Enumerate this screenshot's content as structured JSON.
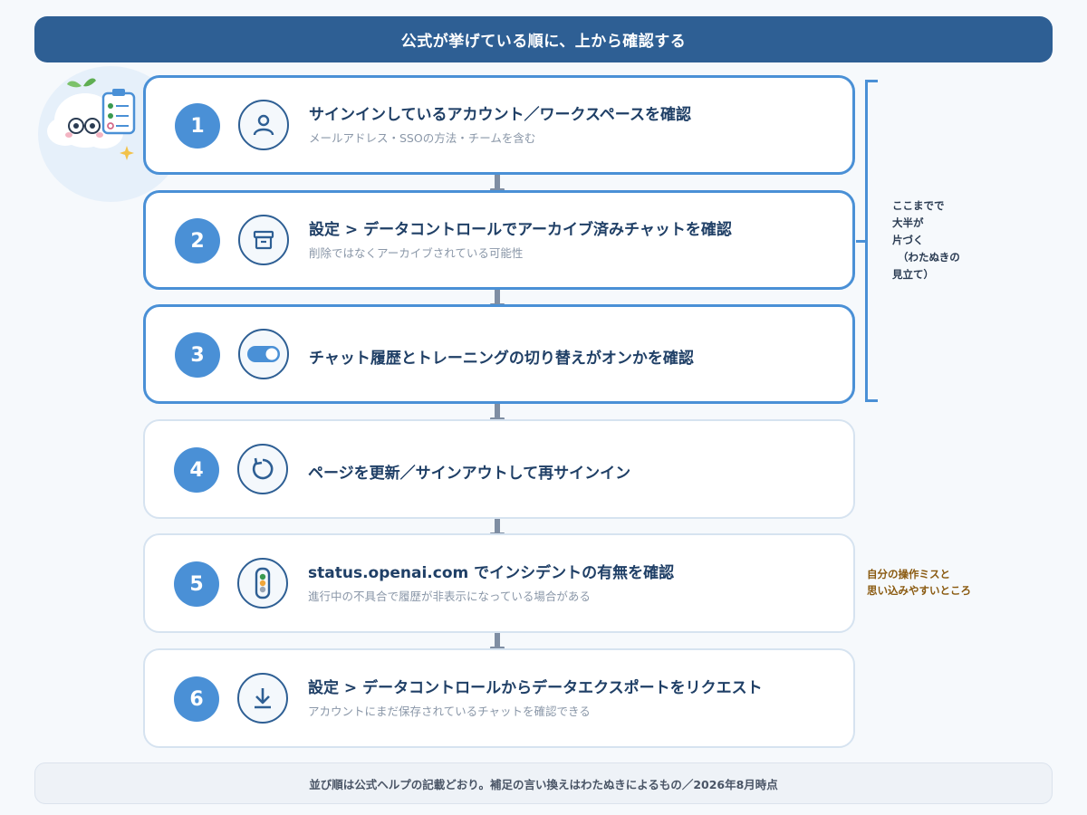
{
  "header": {
    "title": "公式が挙げている順に、上から確認する"
  },
  "steps": [
    {
      "number": "1",
      "icon": "user-icon",
      "title": "サインインしているアカウント／ワークスペースを確認",
      "subtitle": "メールアドレス・SSOの方法・チームを含む",
      "highlighted": true
    },
    {
      "number": "2",
      "icon": "archive-box-icon",
      "title": "設定 > データコントロールでアーカイブ済みチャットを確認",
      "subtitle": "削除ではなくアーカイブされている可能性",
      "highlighted": true
    },
    {
      "number": "3",
      "icon": "toggle-switch-icon",
      "title": "チャット履歴とトレーニングの切り替えがオンかを確認",
      "subtitle": "",
      "highlighted": true
    },
    {
      "number": "4",
      "icon": "refresh-icon",
      "title": "ページを更新／サインアウトして再サインイン",
      "subtitle": "",
      "highlighted": false
    },
    {
      "number": "5",
      "icon": "traffic-light-icon",
      "title": "status.openai.com でインシデントの有無を確認",
      "subtitle": "進行中の不具合で履歴が非表示になっている場合がある",
      "highlighted": false
    },
    {
      "number": "6",
      "icon": "download-icon",
      "title": "設定 > データコントロールからデータエクスポートをリクエスト",
      "subtitle": "アカウントにまだ保存されているチャットを確認できる",
      "highlighted": false
    }
  ],
  "side_note": {
    "line1": "ここまでで",
    "line2": "大半が",
    "line3": "片づく",
    "line4": "（わたぬきの",
    "line5": "見立て）"
  },
  "warn_note": {
    "line1": "自分の操作ミスと",
    "line2": "思い込みやすいところ"
  },
  "footer": {
    "text": "並び順は公式ヘルプの記載どおり。補足の言い換えはわたぬきによるもの／2026年8月時点"
  },
  "colors": {
    "header": "#2e5f94",
    "accent": "#4a90d6",
    "title_text": "#1f3f66",
    "warn_text": "#8a5a10"
  }
}
